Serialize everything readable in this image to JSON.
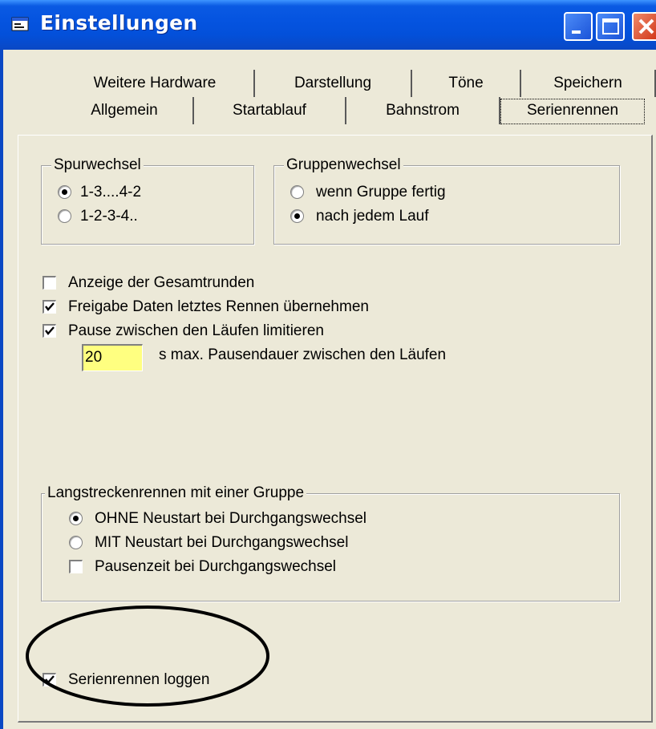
{
  "window": {
    "title": "Einstellungen"
  },
  "tabs": {
    "row1": [
      "Weitere Hardware",
      "Darstellung",
      "Töne",
      "Speichern"
    ],
    "row2": [
      "Allgemein",
      "Startablauf",
      "Bahnstrom",
      "Serienrennen"
    ],
    "active": "Serienrennen"
  },
  "spurwechsel": {
    "legend": "Spurwechsel",
    "options": [
      "1-3....4-2",
      "1-2-3-4.."
    ],
    "selected": "1-3....4-2"
  },
  "gruppenwechsel": {
    "legend": "Gruppenwechsel",
    "options": [
      "wenn Gruppe fertig",
      "nach jedem Lauf"
    ],
    "selected": "nach jedem Lauf"
  },
  "checkboxes": {
    "gesamtrunden": {
      "label": "Anzeige der Gesamtrunden",
      "checked": false
    },
    "freigabe": {
      "label": "Freigabe Daten letztes Rennen übernehmen",
      "checked": true
    },
    "pause": {
      "label": "Pause zwischen den Läufen limitieren",
      "checked": true
    }
  },
  "pause": {
    "value": "20",
    "hint": "s max. Pausendauer zwischen den Läufen"
  },
  "langstrecke": {
    "legend": "Langstreckenrennen mit einer Gruppe",
    "options": [
      "OHNE Neustart bei Durchgangswechsel",
      "MIT Neustart bei Durchgangswechsel"
    ],
    "selected": "OHNE Neustart bei Durchgangswechsel",
    "pausenzeit": {
      "label": "Pausenzeit bei Durchgangswechsel",
      "checked": false
    }
  },
  "logging": {
    "label": "Serienrennen loggen",
    "checked": true
  },
  "colors": {
    "titlebar": "#0554e0",
    "dialog": "#ece9d8",
    "textbox": "#ffff80"
  }
}
